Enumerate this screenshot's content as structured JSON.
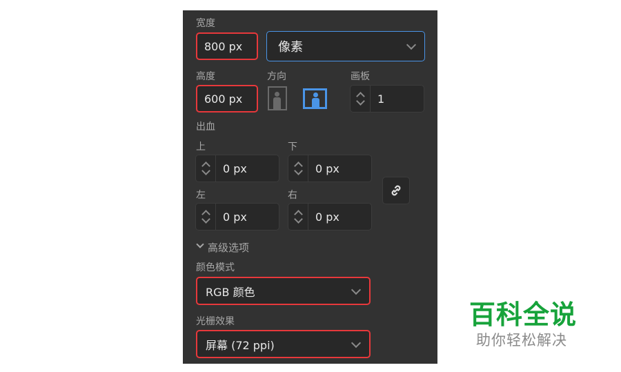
{
  "width": {
    "label": "宽度",
    "value": "800 px"
  },
  "unit": {
    "value": "像素"
  },
  "height": {
    "label": "高度",
    "value": "600 px"
  },
  "orientation": {
    "label": "方向"
  },
  "artboards": {
    "label": "画板",
    "value": "1"
  },
  "bleed": {
    "label": "出血",
    "top_label": "上",
    "top": "0 px",
    "bottom_label": "下",
    "bottom": "0 px",
    "left_label": "左",
    "left": "0 px",
    "right_label": "右",
    "right": "0 px"
  },
  "advanced": {
    "label": "高级选项"
  },
  "color_mode": {
    "label": "颜色模式",
    "value": "RGB 颜色"
  },
  "raster": {
    "label": "光栅效果",
    "value": "屏幕 (72 ppi)"
  },
  "watermark": {
    "title": "百科全说",
    "subtitle": "助你轻松解决"
  },
  "colors": {
    "panel": "#323232",
    "highlight": "#e8383b",
    "accent": "#4a95e8"
  }
}
